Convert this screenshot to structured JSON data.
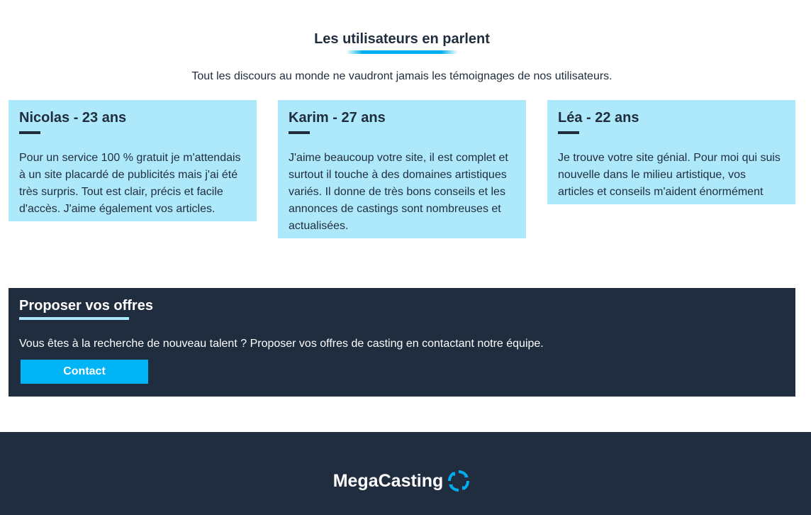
{
  "testimonials": {
    "title": "Les utilisateurs en parlent",
    "subtitle": "Tout les discours au monde ne vaudront jamais les témoignages de nos utilisateurs.",
    "cards": [
      {
        "name": "Nicolas - 23 ans",
        "text": "Pour un service 100 % gratuit je m'attendais à un site placardé de publicités mais j'ai été très surpris. Tout est clair, précis et facile d'accès. J'aime également vos articles."
      },
      {
        "name": "Karim - 27 ans",
        "text": "J'aime beaucoup votre site, il est complet et surtout il touche à des domaines artistiques variés. Il donne de très bons conseils et les annonces de castings sont nombreuses et actualisées."
      },
      {
        "name": "Léa - 22 ans",
        "text": "Je trouve votre site génial. Pour moi qui suis nouvelle dans le milieu artistique, vos articles et conseils m'aident énormément"
      }
    ]
  },
  "offers": {
    "title": "Proposer vos offres",
    "text": "Vous êtes à la recherche de nouveau talent ? Proposer vos offres de casting en contactant notre équipe.",
    "button_label": "Contact"
  },
  "footer": {
    "brand": "MegaCasting",
    "logo_icon": "circular-arrows-icon"
  },
  "colors": {
    "accent": "#00b4f5",
    "card_background": "#aee8fb",
    "dark": "#1f2d3f",
    "text": "#1f2d3d"
  }
}
